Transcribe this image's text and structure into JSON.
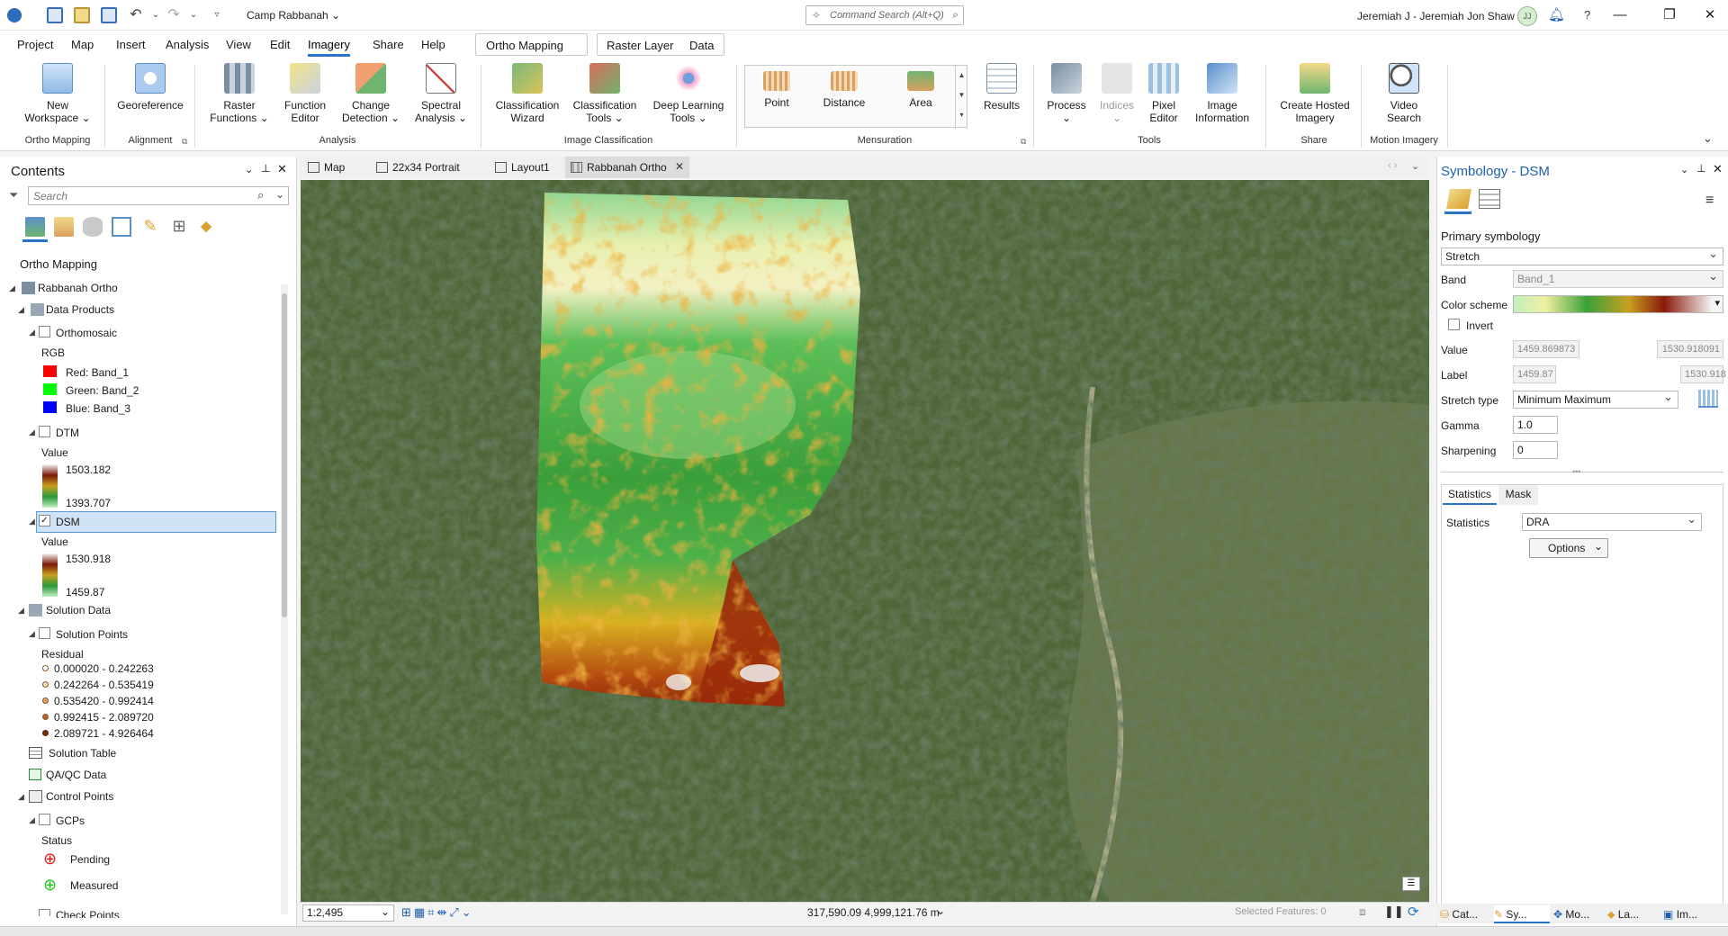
{
  "titlebar": {
    "project": "Camp Rabbanah",
    "command_search_placeholder": "Command Search (Alt+Q)",
    "user": "Jeremiah J - Jeremiah Jon Shaw",
    "initials": "JJ"
  },
  "menu": [
    "Project",
    "Map",
    "Insert",
    "Analysis",
    "View",
    "Edit",
    "Imagery",
    "Share",
    "Help"
  ],
  "context_tabs": {
    "ortho": "Ortho Mapping",
    "raster_layer": "Raster Layer",
    "data": "Data"
  },
  "ribbon": {
    "new_workspace": "New\nWorkspace ⌄",
    "georeference": "Georeference",
    "raster_functions": "Raster\nFunctions ⌄",
    "function_editor": "Function\nEditor",
    "change_detection": "Change\nDetection ⌄",
    "spectral_analysis": "Spectral\nAnalysis ⌄",
    "classification_wizard": "Classification\nWizard",
    "classification_tools": "Classification\nTools ⌄",
    "deep_learning_tools": "Deep Learning\nTools ⌄",
    "point": "Point",
    "distance": "Distance",
    "area": "Area",
    "results": "Results",
    "process": "Process\n⌄",
    "indices": "Indices\n⌄",
    "pixel_editor": "Pixel\nEditor",
    "image_information": "Image\nInformation",
    "create_hosted_imagery": "Create Hosted\nImagery",
    "video_search": "Video\nSearch",
    "groups": {
      "ortho_mapping": "Ortho Mapping",
      "alignment": "Alignment",
      "analysis": "Analysis",
      "image_classification": "Image Classification",
      "mensuration": "Mensuration",
      "tools": "Tools",
      "share": "Share",
      "motion_imagery": "Motion Imagery"
    }
  },
  "contents": {
    "title": "Contents",
    "search_placeholder": "Search",
    "heading": "Ortho Mapping",
    "project": "Rabbanah Ortho",
    "data_products": "Data Products",
    "orthomosaic": "Orthomosaic",
    "rgb": "RGB",
    "red": "Red:  Band_1",
    "green": "Green: Band_2",
    "blue": "Blue:  Band_3",
    "dtm": "DTM",
    "dtm_value": "Value",
    "dtm_max": "1503.182",
    "dtm_min": "1393.707",
    "dsm": "DSM",
    "dsm_value": "Value",
    "dsm_max": "1530.918",
    "dsm_min": "1459.87",
    "solution_data": "Solution Data",
    "solution_points": "Solution Points",
    "residual": "Residual",
    "residuals": [
      "0.000020 - 0.242263",
      "0.242264 - 0.535419",
      "0.535420 - 0.992414",
      "0.992415 - 2.089720",
      "2.089721 - 4.926464"
    ],
    "solution_table": "Solution Table",
    "qaqc_data": "QA/QC Data",
    "control_points": "Control Points",
    "gcps": "GCPs",
    "status": "Status",
    "pending": "Pending",
    "measured": "Measured",
    "check_points": "Check Points"
  },
  "doc_tabs": [
    "Map",
    "22x34 Portrait",
    "Layout1",
    "Rabbanah Ortho"
  ],
  "status": {
    "scale": "1:2,495",
    "coords": "317,590.09 4,999,121.76 m",
    "selected": "Selected Features: 0"
  },
  "symbology": {
    "title": "Symbology - DSM",
    "primary": "Primary symbology",
    "renderer": "Stretch",
    "band_label": "Band",
    "band": "Band_1",
    "color_scheme_label": "Color scheme",
    "invert": "Invert",
    "value_label": "Value",
    "value_min": "1459.869873",
    "value_max": "1530.918091",
    "label_label": "Label",
    "label_min": "1459.87",
    "label_max": "1530.918",
    "stretch_type_label": "Stretch type",
    "stretch_type": "Minimum Maximum",
    "gamma_label": "Gamma",
    "gamma": "1.0",
    "sharpening_label": "Sharpening",
    "sharpening": "0",
    "tab_statistics": "Statistics",
    "tab_mask": "Mask",
    "statistics_label": "Statistics",
    "statistics": "DRA",
    "options": "Options"
  },
  "bottom_tabs": [
    "Cat...",
    "Sy...",
    "Mo...",
    "La...",
    "Im..."
  ]
}
